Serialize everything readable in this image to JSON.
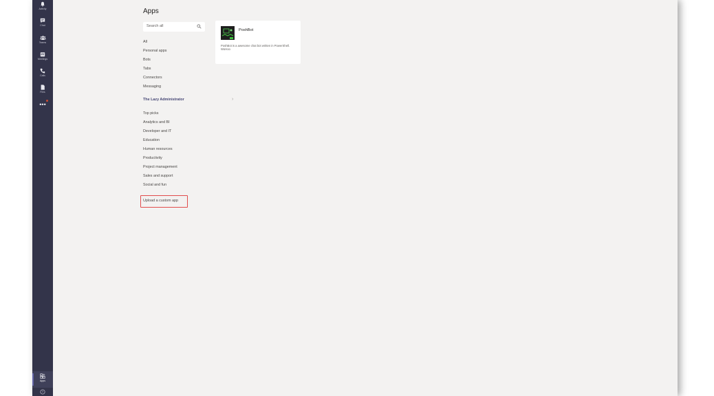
{
  "rail": {
    "items": [
      {
        "label": "Activity",
        "icon": "bell-icon"
      },
      {
        "label": "Chat",
        "icon": "chat-icon"
      },
      {
        "label": "Teams",
        "icon": "teams-icon"
      },
      {
        "label": "Meetings",
        "icon": "calendar-icon"
      },
      {
        "label": "Calls",
        "icon": "phone-icon"
      },
      {
        "label": "Files",
        "icon": "file-icon"
      }
    ],
    "more": "•••",
    "apps_label": "Apps",
    "help_icon": "help-icon"
  },
  "page": {
    "title": "Apps"
  },
  "search": {
    "placeholder": "Search all"
  },
  "nav": {
    "primary": [
      "All",
      "Personal apps",
      "Bots",
      "Tabs",
      "Connectors",
      "Messaging"
    ],
    "org": "The Lazy Administrator",
    "categories": [
      "Top picks",
      "Analytics and BI",
      "Developer and IT",
      "Education",
      "Human resources",
      "Productivity",
      "Project management",
      "Sales and support",
      "Social and fun"
    ],
    "upload": "Upload a custom app"
  },
  "card": {
    "name": "PoshBot",
    "description": "PoshBot is a awesome chat bot written in PowerShell. WoHoo"
  },
  "colors": {
    "rail_bg": "#33344a",
    "accent": "#6264a7",
    "org_text": "#464775",
    "highlight_border": "#e14b4b",
    "canvas": "#f3f2f1"
  }
}
